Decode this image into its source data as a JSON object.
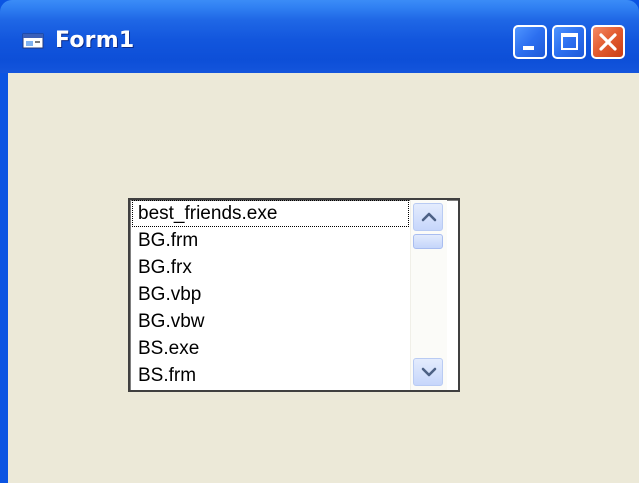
{
  "window": {
    "title": "Form1",
    "buttons": [
      "minimize-icon",
      "maximize-icon",
      "close-icon"
    ],
    "colors": {
      "titlebar": "#0b54e2",
      "client": "#ece9d8",
      "close_button": "#e25a2e"
    }
  },
  "listbox": {
    "items": [
      {
        "label": "best_friends.exe"
      },
      {
        "label": "BG.frm"
      },
      {
        "label": "BG.frx"
      },
      {
        "label": "BG.vbp"
      },
      {
        "label": "BG.vbw"
      },
      {
        "label": "BS.exe"
      },
      {
        "label": "BS.frm"
      }
    ],
    "focused_item": "best_friends.exe",
    "scroll_position": 0
  }
}
